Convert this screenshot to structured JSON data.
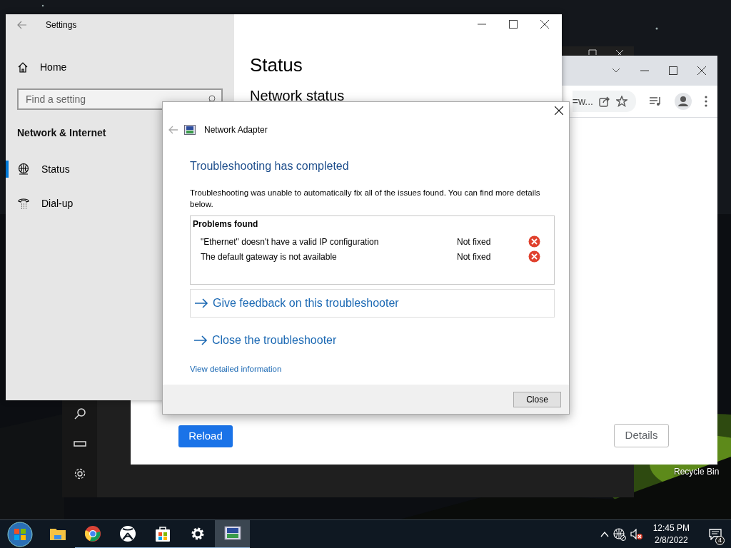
{
  "settings_window": {
    "title": "Settings",
    "home": "Home",
    "search": {
      "placeholder": "Find a setting"
    },
    "section": "Network & Internet",
    "items": [
      {
        "label": "Status",
        "kind": "globe",
        "selected": true
      },
      {
        "label": "Dial-up",
        "kind": "phone",
        "selected": false
      }
    ],
    "heading": "Status",
    "subheading": "Network status"
  },
  "browser": {
    "address_fragment": "=w...",
    "buttons": [
      {
        "label": "Reload",
        "kind": "primary"
      },
      {
        "label": "Details",
        "kind": "outline"
      }
    ]
  },
  "dialog": {
    "title": "Network Adapter",
    "heading": "Troubleshooting has completed",
    "message": "Troubleshooting was unable to automatically fix all of the issues found. You can find more details below.",
    "problems": {
      "title": "Problems found",
      "rows": [
        {
          "problem": "\"Ethernet\" doesn't have a valid IP configuration",
          "status": "Not fixed"
        },
        {
          "problem": "The default gateway is not available",
          "status": "Not fixed"
        }
      ]
    },
    "links": [
      {
        "label": "Give feedback on this troubleshooter",
        "kind": "boxed"
      },
      {
        "label": "Close the troubleshooter",
        "kind": "plain"
      }
    ],
    "details_link": "View detailed information",
    "button": "Close"
  },
  "desktop": {
    "icons": [
      {
        "label": "Recycle Bin"
      }
    ]
  },
  "taskbar": {
    "apps": [
      {
        "kind": "folder",
        "running": false,
        "selected": false
      },
      {
        "kind": "chrome",
        "running": true,
        "selected": false
      },
      {
        "kind": "xbox",
        "running": true,
        "selected": false
      },
      {
        "kind": "store",
        "running": true,
        "selected": false
      },
      {
        "kind": "gear",
        "running": true,
        "selected": false
      },
      {
        "kind": "network",
        "running": true,
        "selected": true
      }
    ],
    "clock": {
      "time": "12:45 PM",
      "date": "2/8/2022"
    },
    "notifications": "4"
  }
}
